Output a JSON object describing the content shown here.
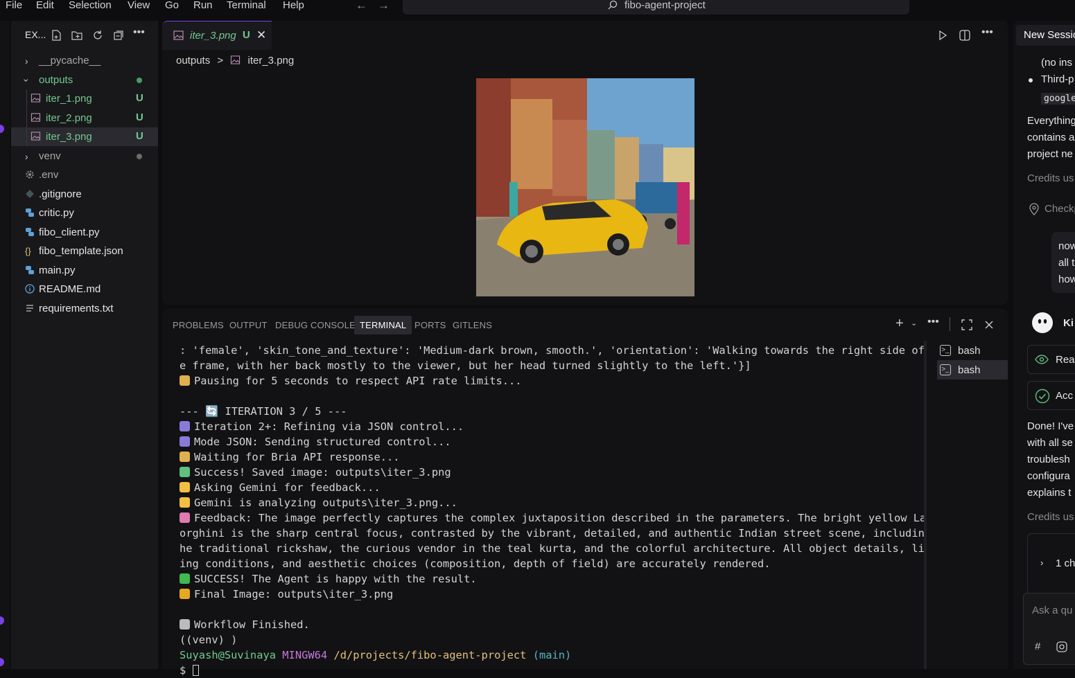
{
  "menu": [
    "File",
    "Edit",
    "Selection",
    "View",
    "Go",
    "Run",
    "Terminal",
    "Help"
  ],
  "search": {
    "text": "fibo-agent-project"
  },
  "explorer": {
    "title": "EX...",
    "items": [
      {
        "label": "__pycache__",
        "kind": "folder-closed",
        "style": "dim",
        "badge": ""
      },
      {
        "label": "outputs",
        "kind": "folder-open",
        "style": "green",
        "badge": "dot-green"
      },
      {
        "label": "iter_1.png",
        "kind": "image",
        "style": "green",
        "badge": "U"
      },
      {
        "label": "iter_2.png",
        "kind": "image",
        "style": "green",
        "badge": "U"
      },
      {
        "label": "iter_3.png",
        "kind": "image",
        "style": "green",
        "badge": "U"
      },
      {
        "label": "venv",
        "kind": "folder-closed",
        "style": "dim",
        "badge": "dot"
      },
      {
        "label": ".env",
        "kind": "gear",
        "style": "dim",
        "badge": ""
      },
      {
        "label": ".gitignore",
        "kind": "git",
        "style": "normal",
        "badge": ""
      },
      {
        "label": "critic.py",
        "kind": "python",
        "style": "normal",
        "badge": ""
      },
      {
        "label": "fibo_client.py",
        "kind": "python",
        "style": "normal",
        "badge": ""
      },
      {
        "label": "fibo_template.json",
        "kind": "json",
        "style": "normal",
        "badge": ""
      },
      {
        "label": "main.py",
        "kind": "python",
        "style": "normal",
        "badge": ""
      },
      {
        "label": "README.md",
        "kind": "info",
        "style": "normal",
        "badge": ""
      },
      {
        "label": "requirements.txt",
        "kind": "lines",
        "style": "normal",
        "badge": ""
      }
    ]
  },
  "editor": {
    "tab": {
      "label": "iter_3.png",
      "status": "U",
      "close": "✕"
    },
    "breadcrumb": {
      "folder": "outputs",
      "sep": ">",
      "file": "iter_3.png"
    }
  },
  "panel": {
    "tabs": [
      "PROBLEMS",
      "OUTPUT",
      "DEBUG CONSOLE",
      "TERMINAL",
      "PORTS",
      "GITLENS"
    ],
    "active_tab": "TERMINAL",
    "terminals": [
      "bash",
      "bash"
    ],
    "lines": [
      {
        "icon": "",
        "text": ": 'female', 'skin_tone_and_texture': 'Medium-dark brown, smooth.', 'orientation': 'Walking towards the right side of th"
      },
      {
        "icon": "",
        "text": "e frame, with her back mostly to the viewer, but her head turned slightly to the left.'}]"
      },
      {
        "icon": "hourglass",
        "text": "Pausing for 5 seconds to respect API rate limits..."
      },
      {
        "icon": "",
        "text": ""
      },
      {
        "icon": "",
        "text": "--- 🔄 ITERATION 3 / 5 ---"
      },
      {
        "icon": "robot",
        "text": "Iteration 2+: Refining via JSON control..."
      },
      {
        "icon": "robot",
        "text": "Mode JSON: Sending structured control..."
      },
      {
        "icon": "hourglass",
        "text": "Waiting for Bria API response..."
      },
      {
        "icon": "picture",
        "text": "Success! Saved image: outputs\\iter_3.png"
      },
      {
        "icon": "face",
        "text": "Asking Gemini for feedback..."
      },
      {
        "icon": "face",
        "text": "Gemini is analyzing outputs\\iter_3.png..."
      },
      {
        "icon": "brain",
        "text": "Feedback: The image perfectly captures the complex juxtaposition described in the parameters. The bright yellow Lamb"
      },
      {
        "icon": "",
        "text": "orghini is the sharp central focus, contrasted by the vibrant, detailed, and authentic Indian street scene, including t"
      },
      {
        "icon": "",
        "text": "he traditional rickshaw, the curious vendor in the teal kurta, and the colorful architecture. All object details, light"
      },
      {
        "icon": "",
        "text": "ing conditions, and aesthetic choices (composition, depth of field) are accurately rendered."
      },
      {
        "icon": "check",
        "text": "SUCCESS! The Agent is happy with the result."
      },
      {
        "icon": "trophy",
        "text": "Final Image: outputs\\iter_3.png"
      },
      {
        "icon": "",
        "text": ""
      },
      {
        "icon": "flag",
        "text": "Workflow Finished."
      },
      {
        "icon": "",
        "text": "((venv) )"
      }
    ],
    "prompt": {
      "user": "Suyash@Suvinaya",
      "host": "MINGW64",
      "path": "/d/projects/fibo-agent-project",
      "branch": "(main)",
      "symbol": "$"
    }
  },
  "chat": {
    "title": "New Session",
    "lines": [
      {
        "text": "(no ins",
        "kind": "text"
      },
      {
        "text": "Third-p",
        "kind": "bullet"
      },
      {
        "text": "google",
        "kind": "code"
      },
      {
        "text": "Everything",
        "kind": "text"
      },
      {
        "text": "contains a",
        "kind": "text"
      },
      {
        "text": "project ne",
        "kind": "text"
      },
      {
        "text": "Credits us",
        "kind": "dim"
      },
      {
        "text": "Checkp",
        "kind": "pin"
      },
      {
        "text": "now",
        "kind": "bubble"
      },
      {
        "text": "all t",
        "kind": "bubble"
      },
      {
        "text": "how",
        "kind": "bubble"
      },
      {
        "text": "Ki",
        "kind": "agent"
      },
      {
        "text": "Rea",
        "kind": "eye-card"
      },
      {
        "text": "Acc",
        "kind": "check-card"
      },
      {
        "text": "Done! I've",
        "kind": "text"
      },
      {
        "text": "with all se",
        "kind": "text"
      },
      {
        "text": "troublesh",
        "kind": "text"
      },
      {
        "text": "configura",
        "kind": "text"
      },
      {
        "text": "explains t",
        "kind": "text"
      },
      {
        "text": "Credits us",
        "kind": "dim"
      },
      {
        "text": "1 ch",
        "kind": "changes"
      }
    ],
    "input_placeholder": "Ask a qu",
    "input_hash": "#"
  },
  "colors": {
    "accent": "#7b3fe4",
    "git_untracked": "#73c991",
    "terminal_bg": "#121214"
  }
}
